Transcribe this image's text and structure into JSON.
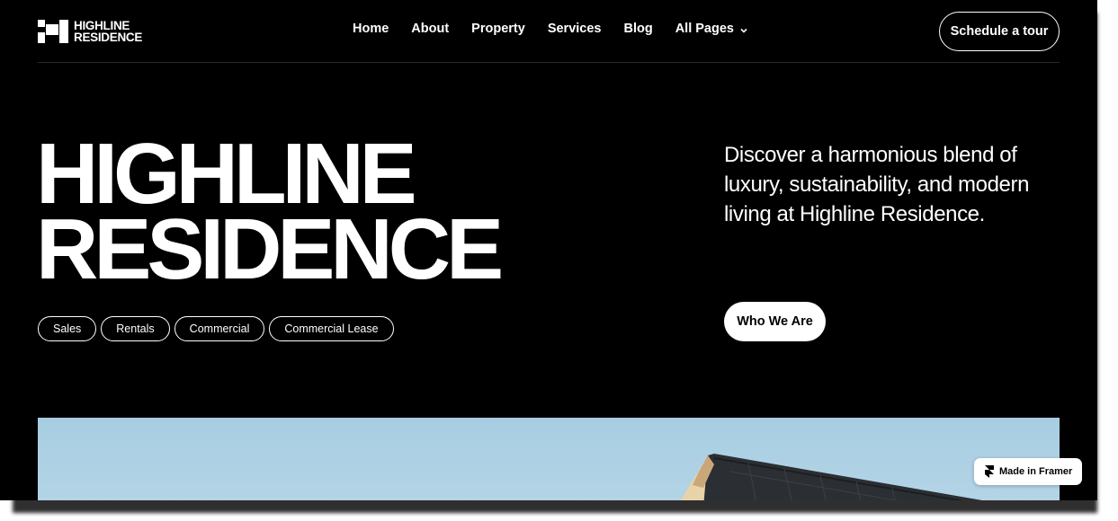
{
  "brand": {
    "line1": "HIGHLINE",
    "line2": "RESIDENCE",
    "logo_icon": "highline-logo-mark"
  },
  "nav": {
    "items": [
      {
        "label": "Home"
      },
      {
        "label": "About"
      },
      {
        "label": "Property"
      },
      {
        "label": "Services"
      },
      {
        "label": "Blog"
      },
      {
        "label": "All Pages",
        "icon": "chevron-down-icon"
      }
    ],
    "cta": "Schedule a tour"
  },
  "hero": {
    "title_line1": "HIGHLINE",
    "title_line2": "RESIDENCE",
    "description": "Discover a harmonious blend of luxury, sustainability, and modern living at Highline Residence.",
    "button": "Who We Are",
    "tags": [
      "Sales",
      "Rentals",
      "Commercial",
      "Commercial Lease"
    ]
  },
  "badge": {
    "label": "Made in Framer",
    "icon": "framer-icon"
  },
  "colors": {
    "background": "#000000",
    "text": "#ffffff",
    "sky": "#a7cde2",
    "roof": "#2b2f33"
  }
}
